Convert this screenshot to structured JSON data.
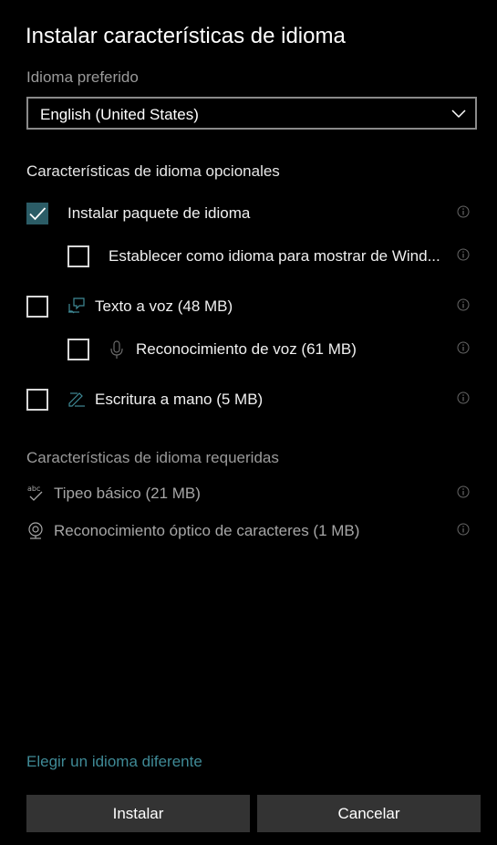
{
  "dialog": {
    "title": "Instalar características de idioma"
  },
  "preferred": {
    "label": "Idioma preferido",
    "value": "English (United States)"
  },
  "optional": {
    "heading": "Características de idioma opcionales",
    "items": [
      {
        "label": "Instalar paquete de idioma",
        "checked": true
      },
      {
        "label": "Establecer como idioma para mostrar de Wind...",
        "checked": false
      },
      {
        "label": "Texto a voz (48 MB)",
        "checked": false,
        "icon": "speech-bubble-icon"
      },
      {
        "label": "Reconocimiento de voz (61 MB)",
        "checked": false,
        "icon": "microphone-icon"
      },
      {
        "label": "Escritura a mano (5 MB)",
        "checked": false,
        "icon": "pen-icon"
      }
    ]
  },
  "required": {
    "heading": "Características de idioma requeridas",
    "items": [
      {
        "label": "Tipeo básico (21 MB)",
        "icon": "spellcheck-icon"
      },
      {
        "label": "Reconocimiento óptico de caracteres (1 MB)",
        "icon": "camera-icon"
      }
    ]
  },
  "footer": {
    "link": "Elegir un idioma diferente",
    "install": "Instalar",
    "cancel": "Cancelar"
  },
  "colors": {
    "background": "#000000",
    "accent_check": "#2b5c66",
    "link": "#3f8a96",
    "button": "#333333"
  }
}
